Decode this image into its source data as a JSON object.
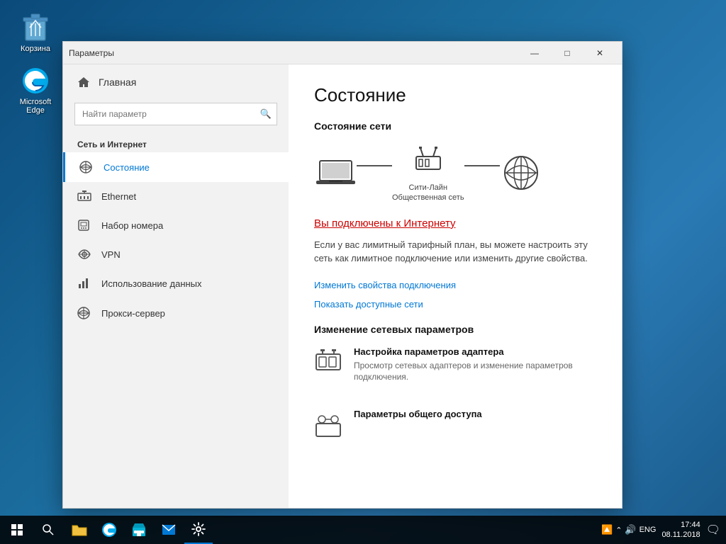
{
  "window": {
    "title": "Параметры",
    "minimize_label": "—",
    "maximize_label": "□",
    "close_label": "✕"
  },
  "sidebar": {
    "home_label": "Главная",
    "search_placeholder": "Найти параметр",
    "section_title": "Сеть и Интернет",
    "items": [
      {
        "id": "status",
        "label": "Состояние",
        "icon": "🌐",
        "active": true
      },
      {
        "id": "ethernet",
        "label": "Ethernet",
        "icon": "🖥",
        "active": false
      },
      {
        "id": "dialup",
        "label": "Набор номера",
        "icon": "📞",
        "active": false
      },
      {
        "id": "vpn",
        "label": "VPN",
        "icon": "🔗",
        "active": false
      },
      {
        "id": "data-usage",
        "label": "Использование данных",
        "icon": "📊",
        "active": false
      },
      {
        "id": "proxy",
        "label": "Прокси-сервер",
        "icon": "🌐",
        "active": false
      }
    ]
  },
  "main": {
    "page_title": "Состояние",
    "network_status_title": "Состояние сети",
    "network_name": "Сити-Лайн",
    "network_type": "Общественная сеть",
    "connected_text": "Вы подключены к Интернету",
    "connected_desc": "Если у вас лимитный тарифный план, вы можете настроить эту сеть как лимитное подключение или изменить другие свойства.",
    "link1": "Изменить свойства подключения",
    "link2": "Показать доступные сети",
    "change_settings_title": "Изменение сетевых параметров",
    "adapter_setting": {
      "title": "Настройка параметров адаптера",
      "desc": "Просмотр сетевых адаптеров и изменение параметров подключения."
    },
    "sharing_setting": {
      "title": "Параметры общего доступа",
      "desc": ""
    }
  },
  "taskbar": {
    "time": "17:44",
    "date": "08.11.2018",
    "lang": "ENG"
  },
  "desktop": {
    "icons": [
      {
        "id": "recycle",
        "label": "Корзина"
      },
      {
        "id": "edge",
        "label": "Microsoft Edge"
      }
    ]
  }
}
